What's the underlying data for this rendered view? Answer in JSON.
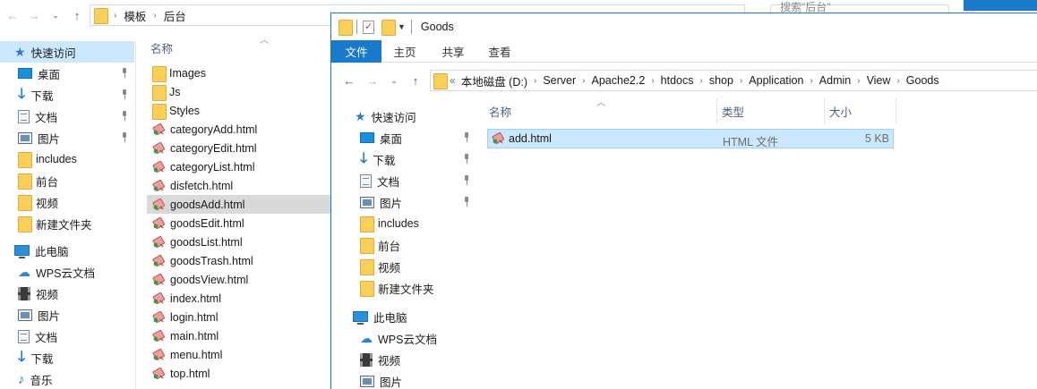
{
  "back_window": {
    "breadcrumb": [
      "模板",
      "后台"
    ],
    "search_placeholder": "搜索\"后台\"",
    "sidebar": [
      {
        "label": "快速访问",
        "icon": "star-icon"
      },
      {
        "label": "桌面",
        "icon": "desktop-icon",
        "pinned": true
      },
      {
        "label": "下载",
        "icon": "download-icon",
        "pinned": true
      },
      {
        "label": "文档",
        "icon": "document-icon",
        "pinned": true
      },
      {
        "label": "图片",
        "icon": "pictures-icon",
        "pinned": true
      },
      {
        "label": "includes",
        "icon": "folder-icon"
      },
      {
        "label": "前台",
        "icon": "folder-icon"
      },
      {
        "label": "视频",
        "icon": "folder-icon"
      },
      {
        "label": "新建文件夹",
        "icon": "folder-icon"
      },
      {
        "label": "此电脑",
        "icon": "computer-icon"
      },
      {
        "label": "WPS云文档",
        "icon": "cloud-icon"
      },
      {
        "label": "视频",
        "icon": "video-icon"
      },
      {
        "label": "图片",
        "icon": "pictures-icon"
      },
      {
        "label": "文档",
        "icon": "document-icon"
      },
      {
        "label": "下载",
        "icon": "download-icon"
      },
      {
        "label": "音乐",
        "icon": "music-icon"
      }
    ],
    "column_name": "名称",
    "files": [
      {
        "name": "Images",
        "type": "folder"
      },
      {
        "name": "Js",
        "type": "folder"
      },
      {
        "name": "Styles",
        "type": "folder"
      },
      {
        "name": "categoryAdd.html",
        "type": "html"
      },
      {
        "name": "categoryEdit.html",
        "type": "html"
      },
      {
        "name": "categoryList.html",
        "type": "html"
      },
      {
        "name": "disfetch.html",
        "type": "html"
      },
      {
        "name": "goodsAdd.html",
        "type": "html",
        "selected": true
      },
      {
        "name": "goodsEdit.html",
        "type": "html"
      },
      {
        "name": "goodsList.html",
        "type": "html"
      },
      {
        "name": "goodsTrash.html",
        "type": "html"
      },
      {
        "name": "goodsView.html",
        "type": "html"
      },
      {
        "name": "index.html",
        "type": "html"
      },
      {
        "name": "login.html",
        "type": "html"
      },
      {
        "name": "main.html",
        "type": "html"
      },
      {
        "name": "menu.html",
        "type": "html"
      },
      {
        "name": "top.html",
        "type": "html"
      }
    ]
  },
  "front_window": {
    "title": "Goods",
    "ribbon_tabs": [
      "文件",
      "主页",
      "共享",
      "查看"
    ],
    "breadcrumb": [
      "本地磁盘 (D:)",
      "Server",
      "Apache2.2",
      "htdocs",
      "shop",
      "Application",
      "Admin",
      "View",
      "Goods"
    ],
    "breadcrumb_prefix": "«",
    "sidebar": [
      {
        "label": "快速访问",
        "icon": "star-icon"
      },
      {
        "label": "桌面",
        "icon": "desktop-icon",
        "pinned": true
      },
      {
        "label": "下载",
        "icon": "download-icon",
        "pinned": true
      },
      {
        "label": "文档",
        "icon": "document-icon",
        "pinned": true
      },
      {
        "label": "图片",
        "icon": "pictures-icon",
        "pinned": true
      },
      {
        "label": "includes",
        "icon": "folder-icon"
      },
      {
        "label": "前台",
        "icon": "folder-icon"
      },
      {
        "label": "视频",
        "icon": "folder-icon"
      },
      {
        "label": "新建文件夹",
        "icon": "folder-icon"
      },
      {
        "label": "此电脑",
        "icon": "computer-icon"
      },
      {
        "label": "WPS云文档",
        "icon": "cloud-icon"
      },
      {
        "label": "视频",
        "icon": "video-icon"
      },
      {
        "label": "图片",
        "icon": "pictures-icon"
      }
    ],
    "columns": {
      "name": "名称",
      "type": "类型",
      "size": "大小"
    },
    "files": [
      {
        "name": "add.html",
        "type": "HTML 文件",
        "size": "5 KB",
        "selected": true
      }
    ]
  },
  "colors": {
    "accent": "#1979ca",
    "selection": "#cce8ff",
    "selection_border": "#99d1ff"
  }
}
